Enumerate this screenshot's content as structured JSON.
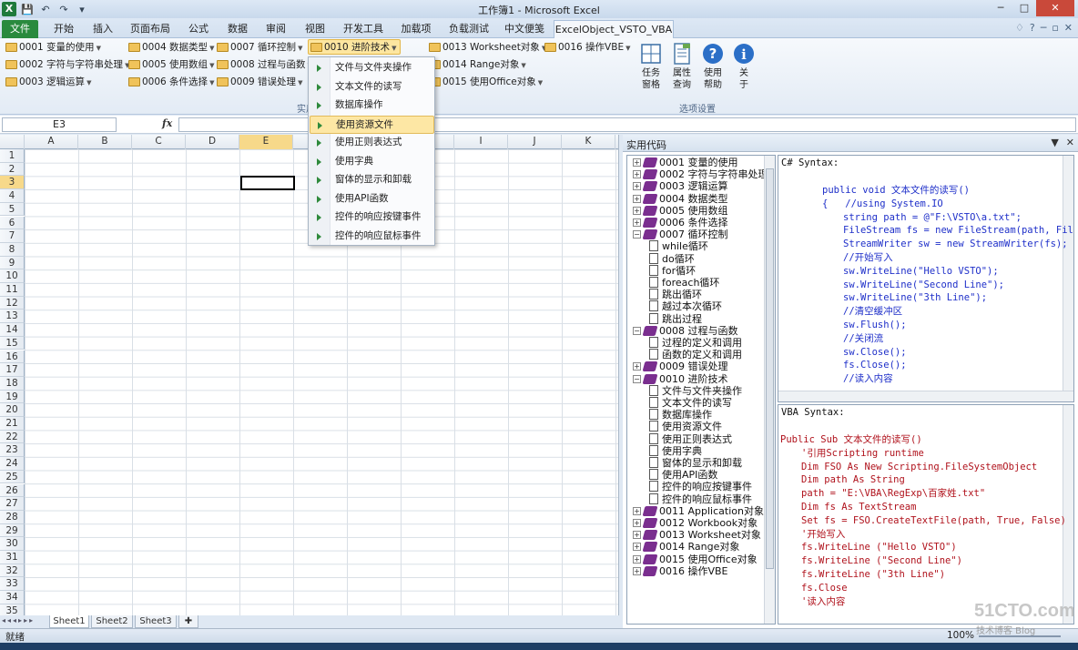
{
  "window": {
    "title": "工作簿1 - Microsoft Excel",
    "app_icon_letter": "X",
    "qat": [
      "💾",
      "↶",
      "↷",
      "▾"
    ],
    "controls": [
      "─",
      "□",
      "✕"
    ]
  },
  "tabs": [
    "文件",
    "开始",
    "插入",
    "页面布局",
    "公式",
    "数据",
    "审阅",
    "视图",
    "开发工具",
    "加载项",
    "负载测试",
    "中文便笺",
    "ExcelObject_VSTO_VBA"
  ],
  "tabs_right": [
    "♢",
    "?",
    "─",
    "▫",
    "✕"
  ],
  "ribbon": {
    "menu_buttons": [
      "0001 变量的使用",
      "0004 数据类型",
      "0007 循环控制",
      "0010 进阶技术",
      "0013 Worksheet对象",
      "0016 操作VBE",
      "0002 字符与字符串处理",
      "0005 使用数组",
      "0008 过程与函数",
      "0014 Range对象",
      "0003 逻辑运算",
      "0006 条件选择",
      "0009 错误处理",
      "0015 使用Office对象"
    ],
    "group1_label": "实用代码",
    "big_buttons": [
      {
        "label1": "任务",
        "label2": "窗格"
      },
      {
        "label1": "属性",
        "label2": "查询"
      },
      {
        "label1": "使用",
        "label2": "帮助"
      },
      {
        "label1": "关",
        "label2": "于"
      }
    ],
    "group2_label": "选项设置"
  },
  "formula_bar": {
    "name_box": "E3",
    "fx": "fx",
    "formula": ""
  },
  "sheet": {
    "columns": [
      "A",
      "B",
      "C",
      "D",
      "E",
      "F",
      "G",
      "H",
      "I",
      "J",
      "K"
    ],
    "rows": [
      "1",
      "2",
      "3",
      "4",
      "5",
      "6",
      "7",
      "8",
      "9",
      "10",
      "11",
      "12",
      "13",
      "14",
      "15",
      "16",
      "17",
      "18",
      "19",
      "20",
      "21",
      "22",
      "23",
      "24",
      "25",
      "26",
      "27",
      "28",
      "29",
      "30",
      "31",
      "32",
      "33",
      "34",
      "35"
    ],
    "selected_column": "E",
    "selected_row": "3",
    "sheet_tabs": [
      "Sheet1",
      "Sheet2",
      "Sheet3"
    ],
    "nav_arrows": "◂◂◂▸▸▸"
  },
  "dropdown": {
    "items": [
      "文件与文件夹操作",
      "文本文件的读写",
      "数据库操作",
      "使用资源文件",
      "使用正则表达式",
      "使用字典",
      "窗体的显示和卸载",
      "使用API函数",
      "控件的响应按键事件",
      "控件的响应鼠标事件"
    ],
    "hovered_index": 3
  },
  "pane": {
    "title": "实用代码",
    "buttons": [
      "▼",
      "✕"
    ],
    "tree": [
      {
        "text": "0001 变量的使用",
        "level": 0,
        "exp": "+"
      },
      {
        "text": "0002 字符与字符串处理",
        "level": 0,
        "exp": "+"
      },
      {
        "text": "0003 逻辑运算",
        "level": 0,
        "exp": "+"
      },
      {
        "text": "0004 数据类型",
        "level": 0,
        "exp": "+"
      },
      {
        "text": "0005 使用数组",
        "level": 0,
        "exp": "+"
      },
      {
        "text": "0006 条件选择",
        "level": 0,
        "exp": "+"
      },
      {
        "text": "0007 循环控制",
        "level": 0,
        "exp": "−"
      },
      {
        "text": "while循环",
        "level": 1
      },
      {
        "text": "do循环",
        "level": 1
      },
      {
        "text": "for循环",
        "level": 1
      },
      {
        "text": "foreach循环",
        "level": 1
      },
      {
        "text": "跳出循环",
        "level": 1
      },
      {
        "text": "越过本次循环",
        "level": 1
      },
      {
        "text": "跳出过程",
        "level": 1
      },
      {
        "text": "0008 过程与函数",
        "level": 0,
        "exp": "−"
      },
      {
        "text": "过程的定义和调用",
        "level": 1
      },
      {
        "text": "函数的定义和调用",
        "level": 1
      },
      {
        "text": "0009 错误处理",
        "level": 0,
        "exp": "+"
      },
      {
        "text": "0010 进阶技术",
        "level": 0,
        "exp": "−"
      },
      {
        "text": "文件与文件夹操作",
        "level": 1
      },
      {
        "text": "文本文件的读写",
        "level": 1
      },
      {
        "text": "数据库操作",
        "level": 1
      },
      {
        "text": "使用资源文件",
        "level": 1
      },
      {
        "text": "使用正则表达式",
        "level": 1
      },
      {
        "text": "使用字典",
        "level": 1
      },
      {
        "text": "窗体的显示和卸载",
        "level": 1
      },
      {
        "text": "使用API函数",
        "level": 1
      },
      {
        "text": "控件的响应按键事件",
        "level": 1
      },
      {
        "text": "控件的响应鼠标事件",
        "level": 1
      },
      {
        "text": "0011 Application对象",
        "level": 0,
        "exp": "+"
      },
      {
        "text": "0012 Workbook对象",
        "level": 0,
        "exp": "+"
      },
      {
        "text": "0013 Worksheet对象",
        "level": 0,
        "exp": "+"
      },
      {
        "text": "0014 Range对象",
        "level": 0,
        "exp": "+"
      },
      {
        "text": "0015 使用Office对象",
        "level": 0,
        "exp": "+"
      },
      {
        "text": "0016 操作VBE",
        "level": 0,
        "exp": "+"
      }
    ],
    "cs": {
      "header": "C# Syntax:",
      "lines": [
        {
          "t": "public void 文本文件的读写()",
          "c": "c-blue",
          "i": 0
        },
        {
          "t": "{   //using System.IO",
          "c": "c-blue",
          "i": 0
        },
        {
          "t": "string path = @\"F:\\VSTO\\a.txt\";",
          "c": "c-blue",
          "i": 1
        },
        {
          "t": "FileStream fs = new FileStream(path, FileMode.",
          "c": "c-blue",
          "i": 1
        },
        {
          "t": "StreamWriter sw = new StreamWriter(fs);",
          "c": "c-blue",
          "i": 1
        },
        {
          "t": "//开始写入",
          "c": "c-blue",
          "i": 1
        },
        {
          "t": "sw.WriteLine(\"Hello VSTO\");",
          "c": "c-blue",
          "i": 1
        },
        {
          "t": "sw.WriteLine(\"Second Line\");",
          "c": "c-blue",
          "i": 1
        },
        {
          "t": "sw.WriteLine(\"3th Line\");",
          "c": "c-blue",
          "i": 1
        },
        {
          "t": "//清空缓冲区",
          "c": "c-blue",
          "i": 1
        },
        {
          "t": "sw.Flush();",
          "c": "c-blue",
          "i": 1
        },
        {
          "t": "//关闭流",
          "c": "c-blue",
          "i": 1
        },
        {
          "t": "sw.Close();",
          "c": "c-blue",
          "i": 1
        },
        {
          "t": "fs.Close();",
          "c": "c-blue",
          "i": 1
        },
        {
          "t": "//读入内容",
          "c": "c-blue",
          "i": 1
        }
      ]
    },
    "vba": {
      "header": "VBA Syntax:",
      "lines": [
        {
          "t": "Public Sub 文本文件的读写()",
          "c": "c-red",
          "i": 0
        },
        {
          "t": "'引用Scripting runtime",
          "c": "c-red",
          "i": 1
        },
        {
          "t": "Dim FSO As New Scripting.FileSystemObject",
          "c": "c-red",
          "i": 1
        },
        {
          "t": "Dim path As String",
          "c": "c-red",
          "i": 1
        },
        {
          "t": "path = \"E:\\VBA\\RegExp\\百家姓.txt\"",
          "c": "c-red",
          "i": 1
        },
        {
          "t": "Dim fs As TextStream",
          "c": "c-red",
          "i": 1
        },
        {
          "t": "Set fs = FSO.CreateTextFile(path, True, False)",
          "c": "c-red",
          "i": 1
        },
        {
          "t": "'开始写入",
          "c": "c-red",
          "i": 1
        },
        {
          "t": "fs.WriteLine (\"Hello VSTO\")",
          "c": "c-red",
          "i": 1
        },
        {
          "t": "fs.WriteLine (\"Second Line\")",
          "c": "c-red",
          "i": 1
        },
        {
          "t": "fs.WriteLine (\"3th Line\")",
          "c": "c-red",
          "i": 1
        },
        {
          "t": "fs.Close",
          "c": "c-red",
          "i": 1
        },
        {
          "t": "'读入内容",
          "c": "c-red",
          "i": 1
        }
      ]
    }
  },
  "status": {
    "ready": "就绪",
    "zoom": "100%"
  },
  "watermark": {
    "main": "51CTO.com",
    "sub": "技术博客  Blog"
  }
}
